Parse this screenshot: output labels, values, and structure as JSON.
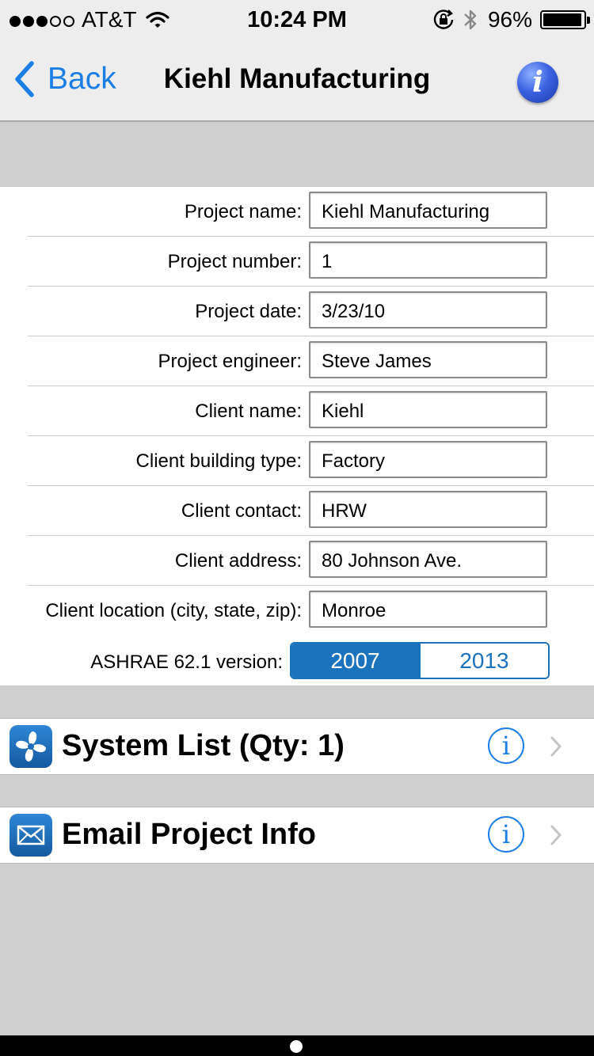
{
  "status_bar": {
    "carrier": "AT&T",
    "time": "10:24 PM",
    "battery": "96%",
    "battery_level": 0.96
  },
  "nav": {
    "back_label": "Back",
    "title": "Kiehl Manufacturing",
    "info_glyph": "i"
  },
  "form": {
    "fields": [
      {
        "label": "Project name:",
        "value": "Kiehl Manufacturing"
      },
      {
        "label": "Project number:",
        "value": "1"
      },
      {
        "label": "Project date:",
        "value": "3/23/10"
      },
      {
        "label": "Project engineer:",
        "value": "Steve James"
      },
      {
        "label": "Client name:",
        "value": "Kiehl"
      },
      {
        "label": "Client building type:",
        "value": "Factory"
      },
      {
        "label": "Client contact:",
        "value": "HRW"
      },
      {
        "label": "Client address:",
        "value": "80 Johnson Ave."
      },
      {
        "label": "Client location (city, state, zip):",
        "value": "Monroe"
      }
    ],
    "ashrae": {
      "label": "ASHRAE 62.1 version:",
      "options": [
        "2007",
        "2013"
      ],
      "selected": "2007"
    }
  },
  "cells": [
    {
      "title": "System List (Qty: 1)",
      "icon": "fan-icon",
      "info_glyph": "i"
    },
    {
      "title": "Email Project Info",
      "icon": "envelope-icon",
      "info_glyph": "i"
    }
  ],
  "colors": {
    "accent": "#1a7ee6",
    "segment": "#1b72bd",
    "background": "#cfcfcf"
  }
}
